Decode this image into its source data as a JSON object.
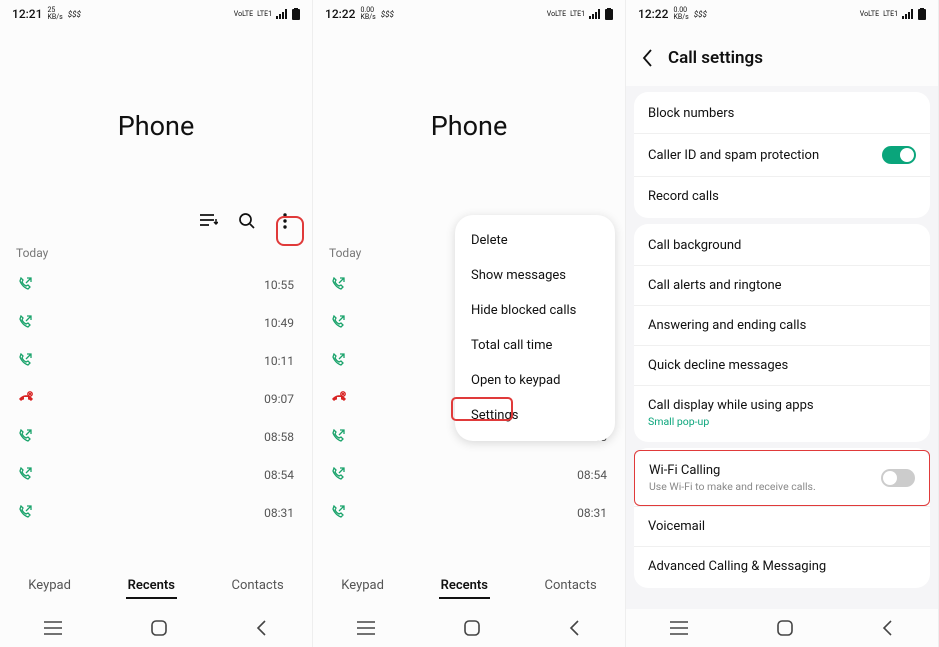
{
  "statusbar": {
    "time1": "12:21",
    "time2": "12:22",
    "time3": "12:22",
    "kbps_top": "25",
    "kbps_bot": "KB/s",
    "kbps_top2": "0.00",
    "dollar": "$$$",
    "right_text": "VoLTE",
    "right_text2": "LTE1"
  },
  "phone": {
    "title": "Phone",
    "section": "Today",
    "calls": [
      {
        "type": "out",
        "time": "10:55"
      },
      {
        "type": "out",
        "time": "10:49"
      },
      {
        "type": "out",
        "time": "10:11"
      },
      {
        "type": "missed",
        "time": "09:07"
      },
      {
        "type": "out",
        "time": "08:58"
      },
      {
        "type": "out",
        "time": "08:54"
      },
      {
        "type": "out",
        "time": "08:31"
      }
    ],
    "tabs": {
      "keypad": "Keypad",
      "recents": "Recents",
      "contacts": "Contacts"
    }
  },
  "menu": {
    "items": [
      "Delete",
      "Show messages",
      "Hide blocked calls",
      "Total call time",
      "Open to keypad",
      "Settings"
    ]
  },
  "settings": {
    "title": "Call settings",
    "g1": {
      "block": "Block numbers",
      "caller_id": "Caller ID and spam protection",
      "record": "Record calls"
    },
    "g2": {
      "bg": "Call background",
      "alerts": "Call alerts and ringtone",
      "answer": "Answering and ending calls",
      "decline": "Quick decline messages",
      "display": "Call display while using apps",
      "display_sub": "Small pop-up"
    },
    "g3": {
      "wifi": "Wi-Fi Calling",
      "wifi_sub": "Use Wi-Fi to make and receive calls.",
      "vm": "Voicemail",
      "adv": "Advanced Calling & Messaging"
    }
  }
}
